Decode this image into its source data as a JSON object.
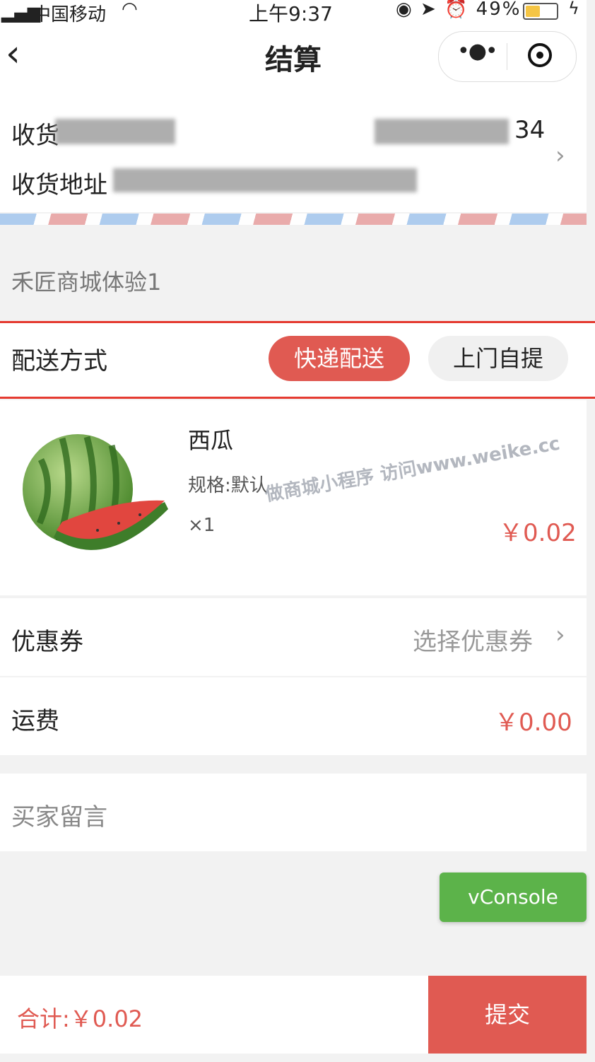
{
  "status_bar": {
    "carrier": "中国移动",
    "time": "上午9:37",
    "battery": "49%"
  },
  "nav": {
    "title": "结算"
  },
  "address": {
    "receiver_prefix": "收货",
    "phone_suffix": "34",
    "address_prefix": "收货地址"
  },
  "shop": {
    "name": "禾匠商城体验1"
  },
  "delivery": {
    "label": "配送方式",
    "express": "快递配送",
    "pickup": "上门自提"
  },
  "product": {
    "name": "西瓜",
    "spec": "规格:默认",
    "qty": "×1",
    "price": "￥0.02"
  },
  "watermark": "做商城小程序 访问www.weike.cc",
  "coupon": {
    "label": "优惠券",
    "value": "选择优惠券"
  },
  "freight": {
    "label": "运费",
    "value": "￥0.00"
  },
  "message": {
    "placeholder": "买家留言"
  },
  "vconsole": "vConsole",
  "footer": {
    "total": "合计:￥0.02",
    "submit": "提交"
  }
}
